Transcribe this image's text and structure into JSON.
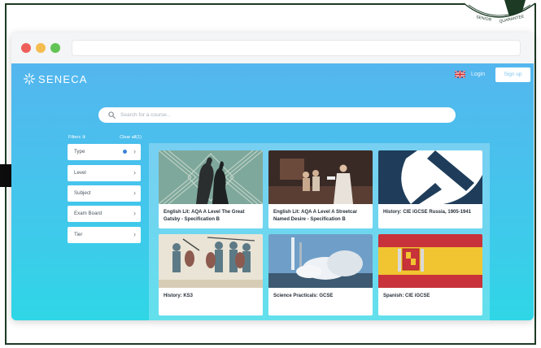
{
  "brand": {
    "name": "SENECA"
  },
  "header": {
    "login_label": "Login",
    "signup_label": "Sign up"
  },
  "search": {
    "placeholder": "Search for a course..."
  },
  "filters": {
    "title": "Filters ③",
    "clear_label": "Clear all(1)",
    "items": [
      {
        "label": "Type",
        "active": true
      },
      {
        "label": "Level",
        "active": false
      },
      {
        "label": "Subject",
        "active": false
      },
      {
        "label": "Exam Board",
        "active": false
      },
      {
        "label": "Tier",
        "active": false
      }
    ]
  },
  "courses": [
    {
      "title": "English Lit: AQA A Level The Great Gatsby - Specification B",
      "image": "gatsby-art-deco"
    },
    {
      "title": "English Lit: AQA A Level A Streetcar Named Desire - Specification B",
      "image": "stage-play"
    },
    {
      "title": "History: CIE iGCSE Russia, 1905-1941",
      "image": "hammer-sickle"
    },
    {
      "title": "History: KS3",
      "image": "bayeux-tapestry"
    },
    {
      "title": "Science Practicals: GCSE",
      "image": "rocket-launch"
    },
    {
      "title": "Spanish: CIE iGCSE",
      "image": "spanish-flag"
    }
  ],
  "stamp": {
    "text": "SENIOR QUARANTEE"
  },
  "colors": {
    "accent": "#43c6ec",
    "signup_text": "#7fc6ee",
    "filter_dot": "#3b82d6"
  },
  "icons": [
    "seneca-logo-icon",
    "uk-flag-icon",
    "search-icon",
    "chevron-right-icon",
    "pointer-arrow-icon"
  ]
}
